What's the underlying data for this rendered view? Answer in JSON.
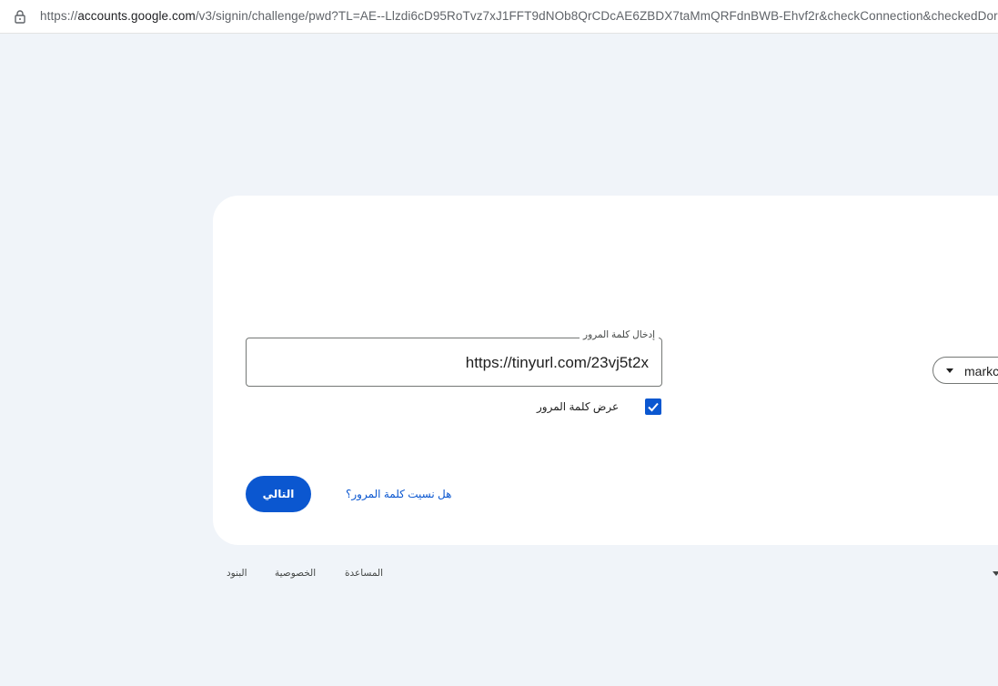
{
  "address_bar": {
    "url_prefix": "https://",
    "url_host": "accounts.google.com",
    "url_rest": "/v3/signin/challenge/pwd?TL=AE--Llzdi6cD95RoTvz7xJ1FFT9dNOb8QrCDcAE6ZBDX7taMmQRFdnBWB-Ehvf2r&checkConnection&checkedDor"
  },
  "account_chip": {
    "text": "markc",
    "icon": "caret-down-icon"
  },
  "password_field": {
    "label": "إدخال كلمة المرور",
    "value": "https://tinyurl.com/23vj5t2x"
  },
  "show_password": {
    "label": "عرض كلمة المرور",
    "checked": true
  },
  "actions": {
    "next_label": "التالي",
    "forgot_label": "هل نسيت كلمة المرور؟"
  },
  "footer": {
    "terms": "البنود",
    "privacy": "الخصوصية",
    "help": "المساعدة"
  },
  "colors": {
    "background": "#f0f4f9",
    "card": "#ffffff",
    "accent": "#0b57d0"
  }
}
